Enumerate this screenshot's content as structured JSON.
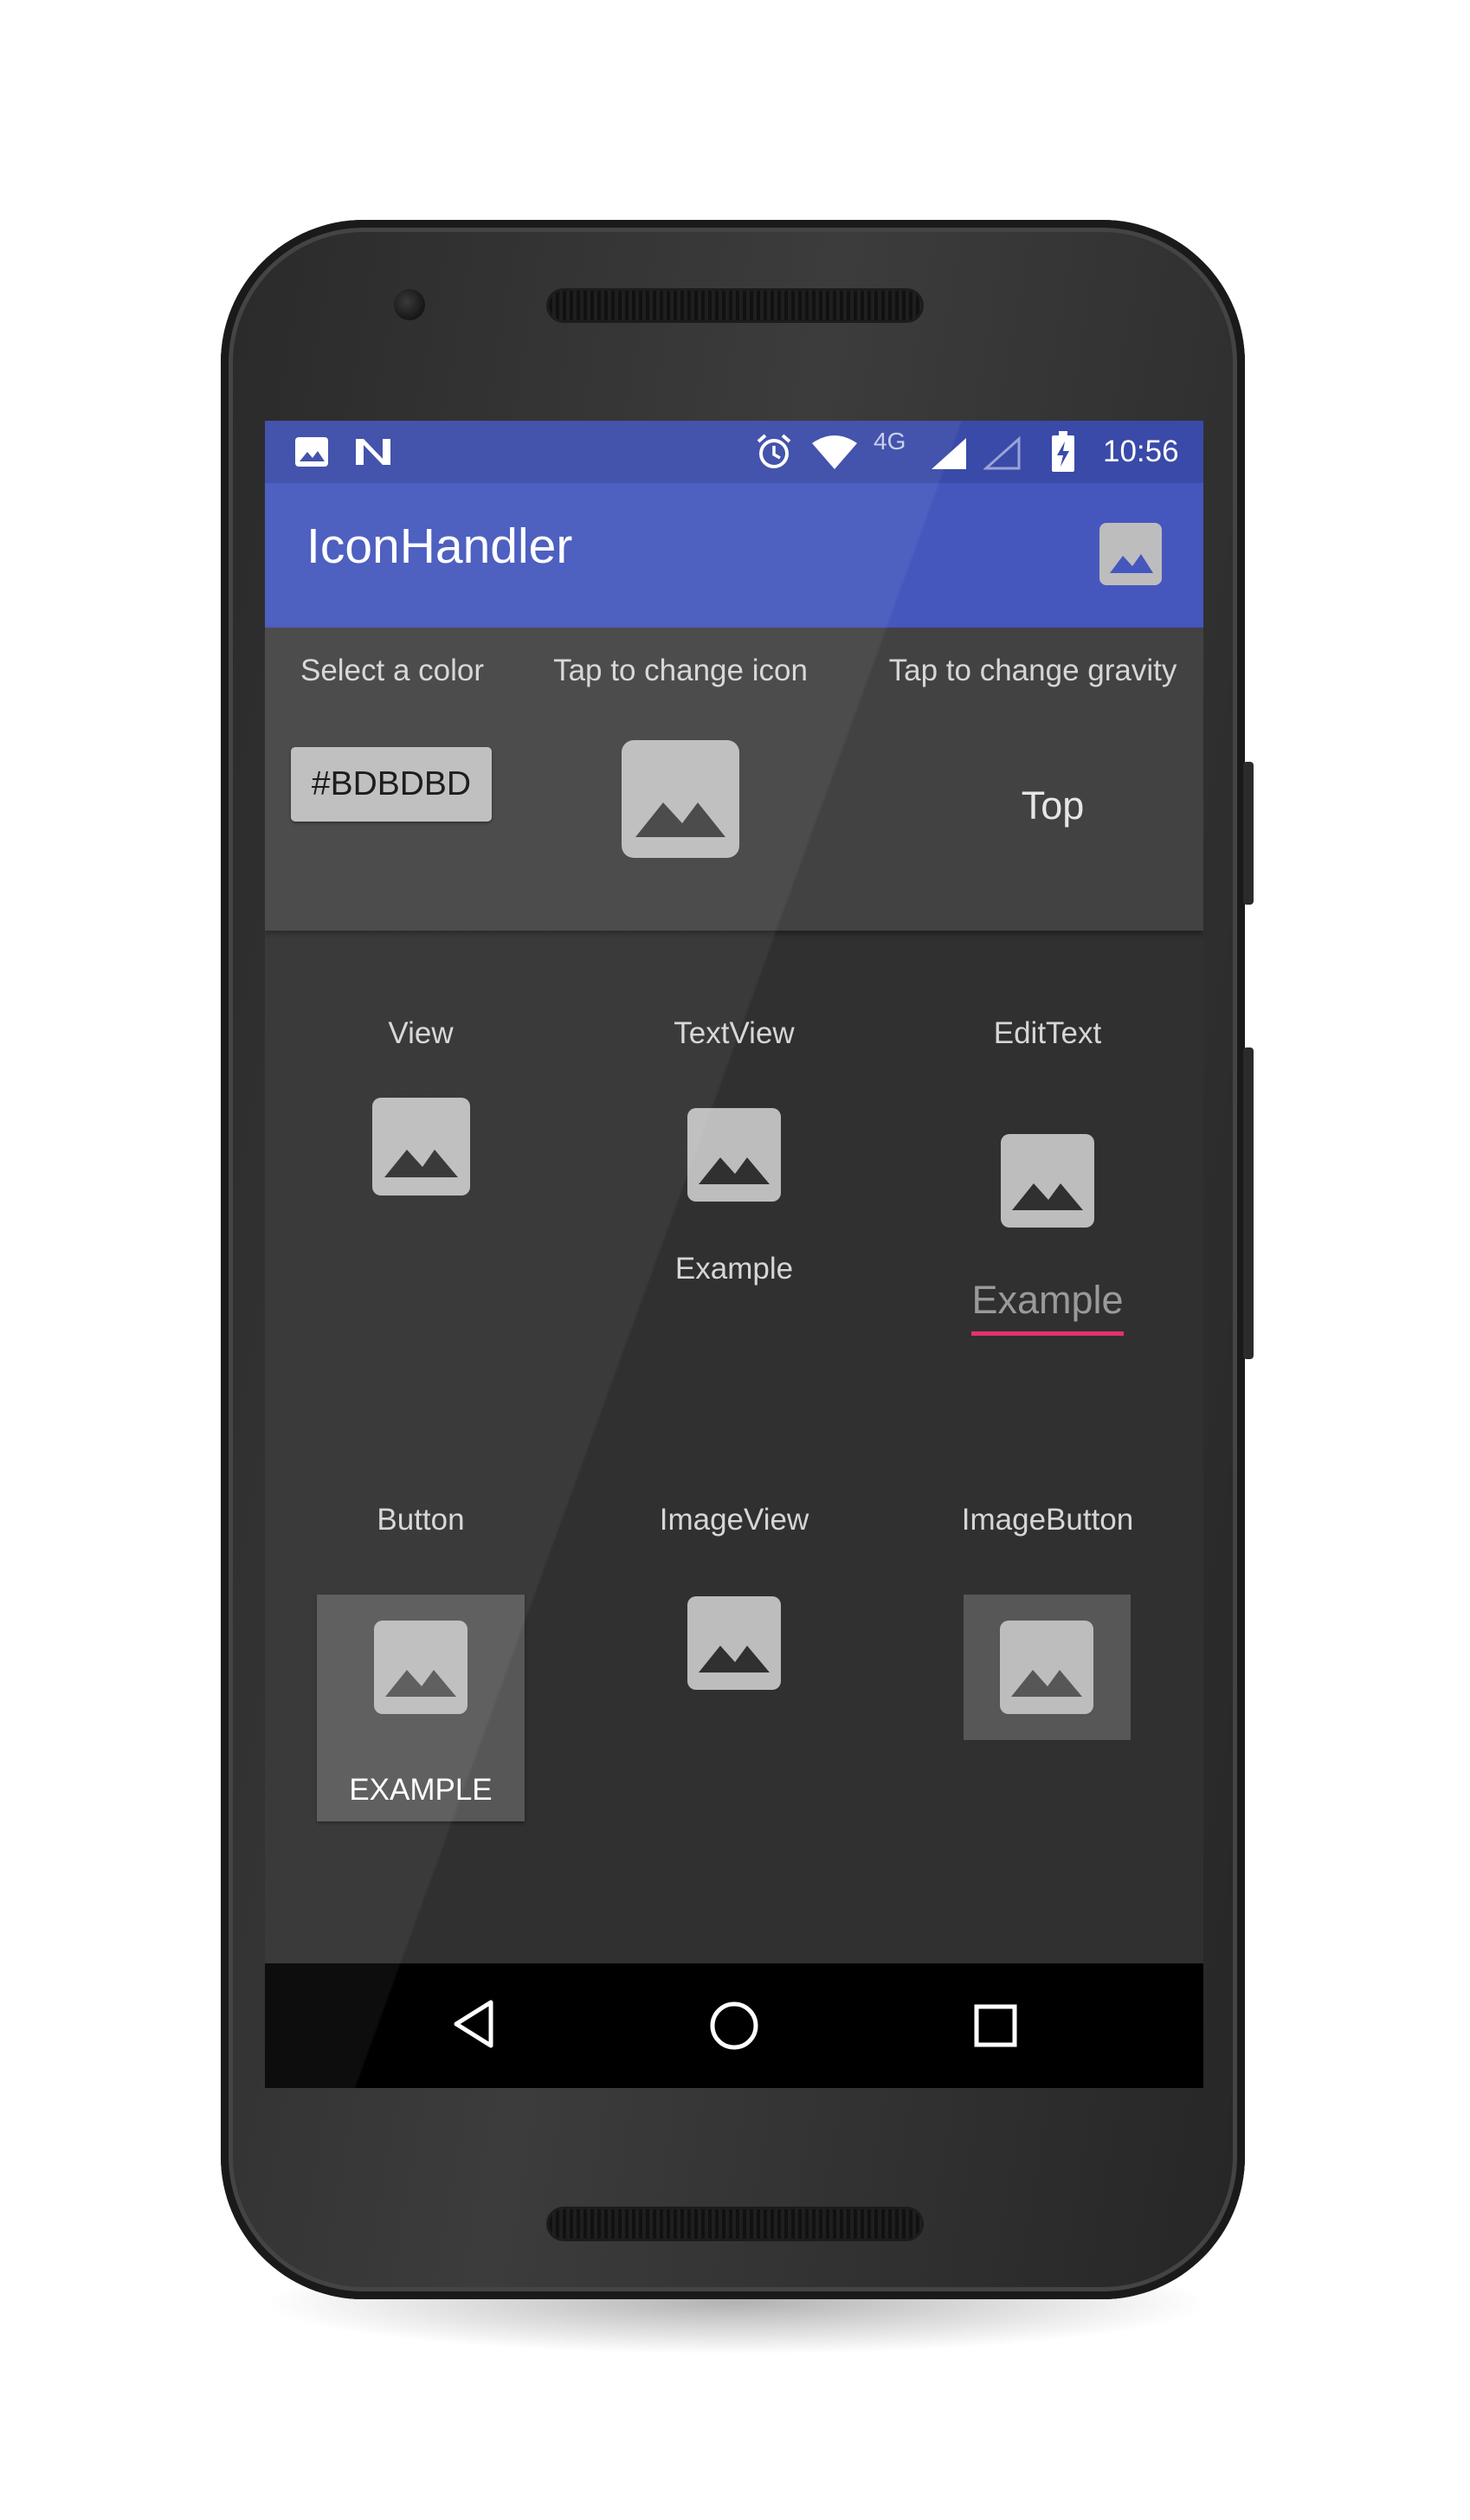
{
  "statusbar": {
    "time": "10:56",
    "network_type": "4G",
    "icons": [
      "image-notification-icon",
      "n-notification-icon",
      "alarm-icon",
      "wifi-icon",
      "signal-icon",
      "signal-empty-icon",
      "battery-charging-icon"
    ]
  },
  "appbar": {
    "title": "IconHandler",
    "action_icon": "image-icon"
  },
  "controls": {
    "color_label": "Select a color",
    "color_value": "#BDBDBD",
    "icon_label": "Tap to change icon",
    "gravity_label": "Tap to change gravity",
    "gravity_value": "Top"
  },
  "demos": {
    "view": {
      "label": "View"
    },
    "textview": {
      "label": "TextView",
      "text": "Example"
    },
    "edittext": {
      "label": "EditText",
      "text": "Example"
    },
    "button": {
      "label": "Button",
      "text": "EXAMPLE"
    },
    "imageview": {
      "label": "ImageView"
    },
    "imagebutton": {
      "label": "ImageButton"
    }
  },
  "navbar": {
    "icons": [
      "back-icon",
      "home-icon",
      "recents-icon"
    ]
  },
  "colors": {
    "primary": "#4557BD",
    "primary_dark": "#3A4AA8",
    "accent": "#E2336B",
    "icon_tint": "#BDBDBD",
    "background": "#303030",
    "surface": "#424242"
  }
}
